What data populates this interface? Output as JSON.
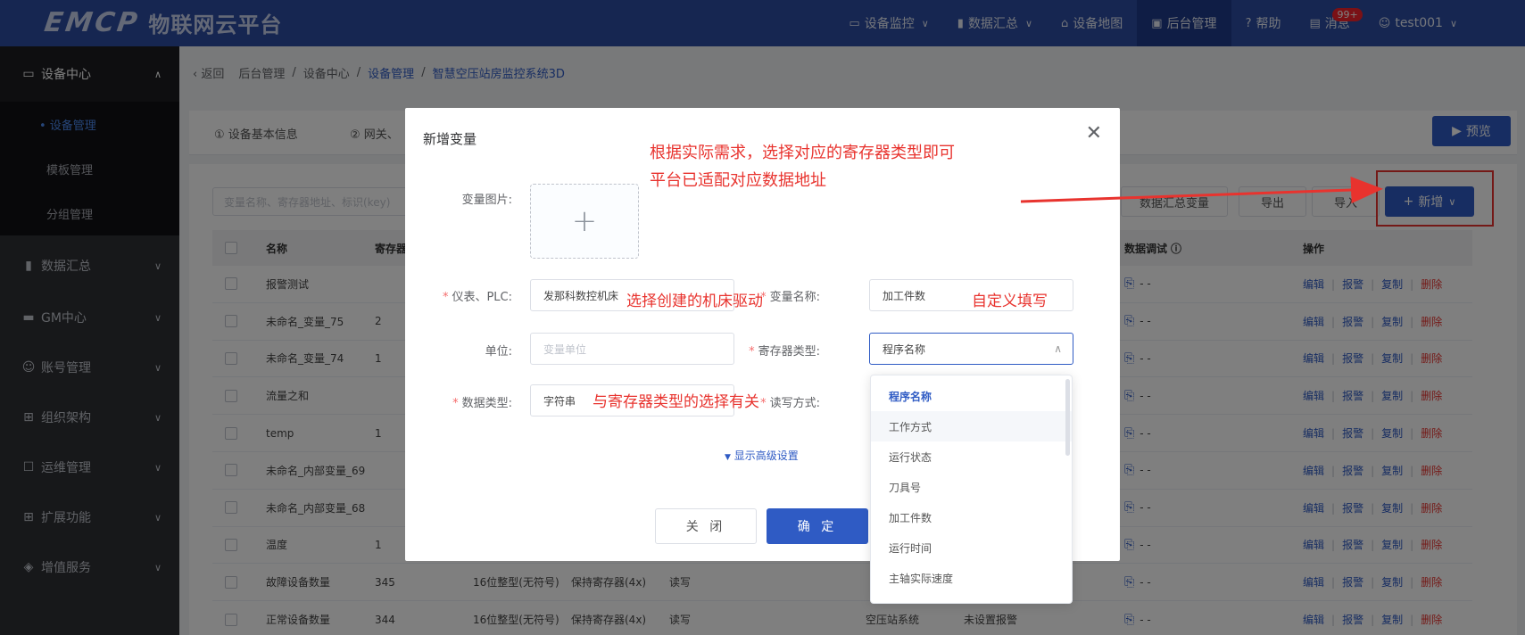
{
  "header": {
    "logo_mark": "EMCP",
    "logo_text": "物联网云平台",
    "nav": [
      {
        "label": "设备监控",
        "icon": "monitor-icon",
        "caret": true
      },
      {
        "label": "数据汇总",
        "icon": "bar-chart-icon",
        "caret": true
      },
      {
        "label": "设备地图",
        "icon": "map-pin-icon",
        "caret": false
      },
      {
        "label": "后台管理",
        "icon": "admin-icon",
        "caret": false,
        "active": true
      },
      {
        "label": "帮助",
        "icon": "help-icon",
        "caret": false
      },
      {
        "label": "消息",
        "icon": "message-icon",
        "caret": false,
        "badge": "99+"
      },
      {
        "label": "test001",
        "icon": "user-icon",
        "caret": true
      }
    ]
  },
  "sidebar": {
    "open_group": {
      "label": "设备中心",
      "icon": "monitor-icon"
    },
    "sub_items": [
      {
        "label": "• 设备管理",
        "active": true
      },
      {
        "label": "模板管理"
      },
      {
        "label": "分组管理"
      }
    ],
    "groups": [
      {
        "label": "数据汇总",
        "icon": "bar-chart-icon"
      },
      {
        "label": "GM中心",
        "icon": "printer-icon"
      },
      {
        "label": "账号管理",
        "icon": "user-icon"
      },
      {
        "label": "组织架构",
        "icon": "org-icon"
      },
      {
        "label": "运维管理",
        "icon": "tool-icon"
      },
      {
        "label": "扩展功能",
        "icon": "grid-icon"
      },
      {
        "label": "增值服务",
        "icon": "diamond-icon"
      }
    ]
  },
  "breadcrumb": {
    "back": "返回",
    "items": [
      "后台管理",
      "设备中心",
      "设备管理",
      "智慧空压站房监控系统3D"
    ]
  },
  "tabs": [
    "① 设备基本信息",
    "② 网关、"
  ],
  "toolbar": {
    "preview": "预览",
    "search_placeholder": "变量名称、寄存器地址、标识(key)",
    "summary_var": "数据汇总变量",
    "export": "导出",
    "import": "导入",
    "add": "新增"
  },
  "table": {
    "headers": {
      "name": "名称",
      "reg": "寄存器",
      "debug": "数据调试",
      "ops": "操作"
    },
    "ops": {
      "edit": "编辑",
      "alarm": "报警",
      "copy": "复制",
      "delete": "删除"
    },
    "debug_value": "- -",
    "rows": [
      {
        "name": "报警测试",
        "reg": ""
      },
      {
        "name": "未命名_变量_75",
        "reg": "2"
      },
      {
        "name": "未命名_变量_74",
        "reg": "1"
      },
      {
        "name": "流量之和",
        "reg": ""
      },
      {
        "name": "temp",
        "reg": "1"
      },
      {
        "name": "未命名_内部变量_69",
        "reg": ""
      },
      {
        "name": "未命名_内部变量_68",
        "reg": ""
      },
      {
        "name": "温度",
        "reg": "1"
      },
      {
        "name": "故障设备数量",
        "reg": "345",
        "dtype": "16位整型(无符号)",
        "rtype": "保持寄存器(4x)",
        "rw": "读写"
      },
      {
        "name": "正常设备数量",
        "reg": "344",
        "dtype": "16位整型(无符号)",
        "rtype": "保持寄存器(4x)",
        "rw": "读写",
        "group": "空压站系统",
        "alarm": "未设置报警"
      }
    ]
  },
  "modal": {
    "title": "新增变量",
    "image_label": "变量图片:",
    "plc_label": "仪表、PLC:",
    "plc_value": "发那科数控机床",
    "name_label": "变量名称:",
    "name_value": "加工件数",
    "unit_label": "单位:",
    "unit_placeholder": "变量单位",
    "reg_type_label": "寄存器类型:",
    "reg_type_value": "程序名称",
    "data_type_label": "数据类型:",
    "data_type_value": "字符串",
    "rw_label": "读写方式:",
    "advanced": "显示高级设置",
    "close": "关 闭",
    "confirm": "确 定"
  },
  "dropdown": {
    "options": [
      "程序名称",
      "工作方式",
      "运行状态",
      "刀具号",
      "加工件数",
      "运行时间",
      "主轴实际速度"
    ]
  },
  "annotations": {
    "main_line1": "根据实际需求，选择对应的寄存器类型即可",
    "main_line2": "平台已适配对应数据地址",
    "plc_note": "选择创建的机床驱动",
    "name_note": "自定义填写",
    "dtype_note": "与寄存器类型的选择有关"
  },
  "colors": {
    "primary": "#2f5bc4",
    "annotation": "#e8332e",
    "header": "#2d4da3",
    "sidebar": "#2f3034"
  }
}
